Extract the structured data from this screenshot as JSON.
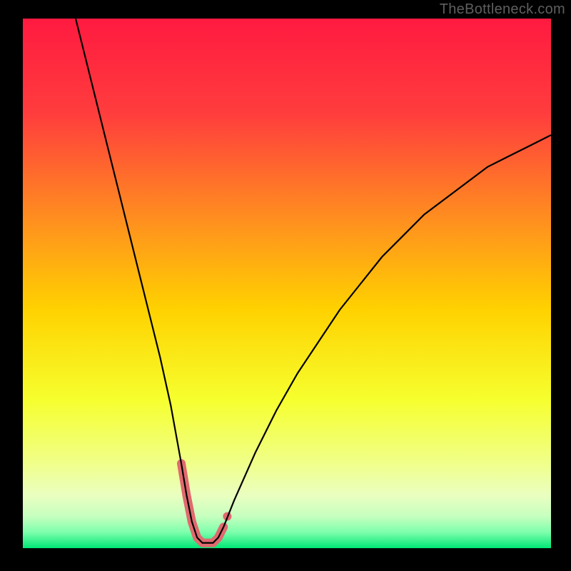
{
  "watermark": "TheBottleneck.com",
  "chart_data": {
    "type": "line",
    "title": "",
    "xlabel": "",
    "ylabel": "",
    "xlim": [
      0,
      100
    ],
    "ylim": [
      0,
      100
    ],
    "annotations": [],
    "background_gradient": {
      "top": "#ff1a40",
      "mid_upper": "#ffbf00",
      "mid_lower": "#f6ff66",
      "bottom": "#00e676"
    },
    "series": [
      {
        "name": "bottleneck-curve",
        "color": "#000000",
        "stroke_width": 2,
        "x": [
          10,
          12,
          14,
          16,
          18,
          20,
          22,
          24,
          26,
          28,
          30,
          31,
          32,
          33,
          34,
          35,
          36,
          37,
          38,
          40,
          44,
          48,
          52,
          56,
          60,
          64,
          68,
          72,
          76,
          80,
          84,
          88,
          92,
          96,
          100
        ],
        "values": [
          100,
          92,
          84,
          76,
          68,
          60,
          52,
          44,
          36,
          27,
          16,
          10,
          5,
          2,
          1,
          1,
          1,
          2,
          4,
          9,
          18,
          26,
          33,
          39,
          45,
          50,
          55,
          59,
          63,
          66,
          69,
          72,
          74,
          76,
          78
        ]
      },
      {
        "name": "trough-marker",
        "color": "#e06a6f",
        "stroke_width": 12,
        "linecap": "round",
        "x": [
          30,
          31,
          32,
          33,
          34,
          35,
          36,
          37,
          38
        ],
        "values": [
          16,
          10,
          5,
          2,
          1,
          1,
          1,
          2,
          4
        ]
      }
    ],
    "marker_point": {
      "x": 38.7,
      "y": 6,
      "color": "#e06a6f",
      "r": 6
    }
  }
}
